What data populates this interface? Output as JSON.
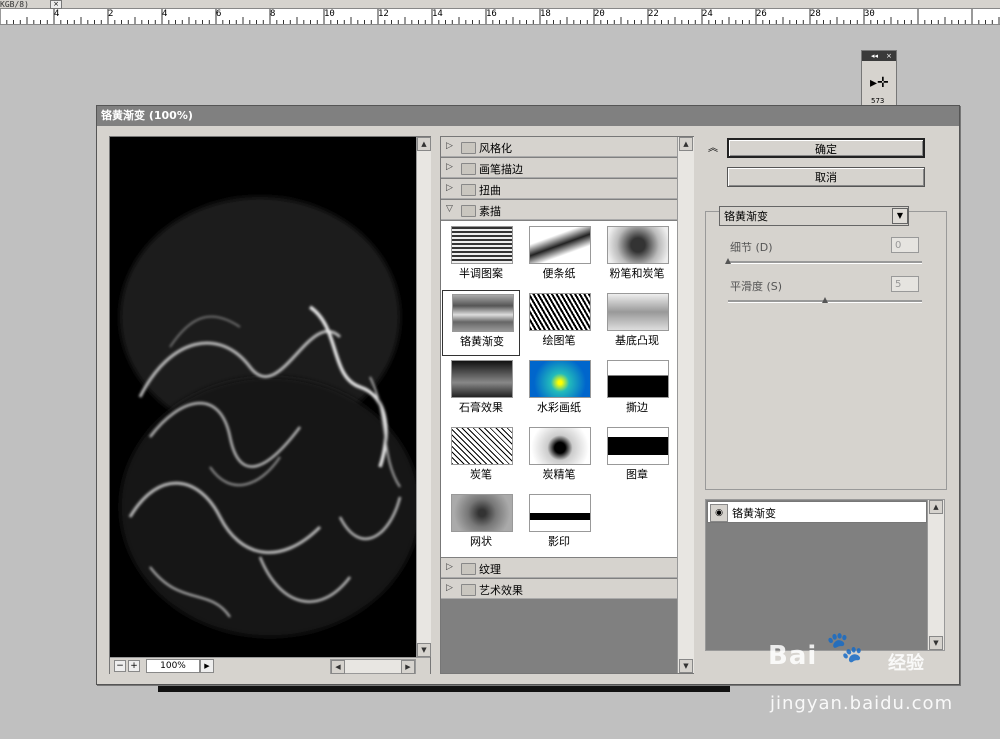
{
  "ruler": {
    "corner": "KGB/8)",
    "labels": [
      "4",
      "2",
      "4",
      "6",
      "8",
      "10",
      "12",
      "14",
      "16",
      "18",
      "20",
      "22",
      "24",
      "26",
      "28",
      "30"
    ]
  },
  "tool_panel": {
    "collapse": "◂◂",
    "close": "×",
    "move_icon": "▸✛",
    "number": "573"
  },
  "dialog": {
    "title": "铬黄渐变 (100%)",
    "ok_label": "确定",
    "cancel_label": "取消"
  },
  "preview": {
    "zoom_out": "−",
    "zoom_in": "+",
    "zoom_level": "100%"
  },
  "gallery": {
    "categories_top": [
      {
        "label": "风格化",
        "expanded": false
      },
      {
        "label": "画笔描边",
        "expanded": false
      },
      {
        "label": "扭曲",
        "expanded": false
      },
      {
        "label": "素描",
        "expanded": true
      }
    ],
    "thumbnails": [
      {
        "label": "半调图案"
      },
      {
        "label": "便条纸"
      },
      {
        "label": "粉笔和炭笔"
      },
      {
        "label": "铬黄渐变",
        "selected": true
      },
      {
        "label": "绘图笔"
      },
      {
        "label": "基底凸现"
      },
      {
        "label": "石膏效果"
      },
      {
        "label": "水彩画纸"
      },
      {
        "label": "撕边"
      },
      {
        "label": "炭笔"
      },
      {
        "label": "炭精笔"
      },
      {
        "label": "图章"
      },
      {
        "label": "网状"
      },
      {
        "label": "影印"
      }
    ],
    "categories_bottom": [
      {
        "label": "纹理",
        "expanded": false
      },
      {
        "label": "艺术效果",
        "expanded": false
      }
    ]
  },
  "settings": {
    "filter_name": "铬黄渐变",
    "detail_label": "细节 (D)",
    "detail_value": "0",
    "smoothness_label": "平滑度 (S)",
    "smoothness_value": "5",
    "detail_max": 10,
    "smoothness_max": 10
  },
  "layers": {
    "items": [
      {
        "name": "铬黄渐变"
      }
    ]
  },
  "watermark": {
    "logo": "Bai",
    "logo_cn": "经验",
    "url": "jingyan.baidu.com"
  },
  "colors": {
    "dialog_bg": "#d6d3ce",
    "title_bar": "#808080",
    "panel_gray": "#808080"
  }
}
